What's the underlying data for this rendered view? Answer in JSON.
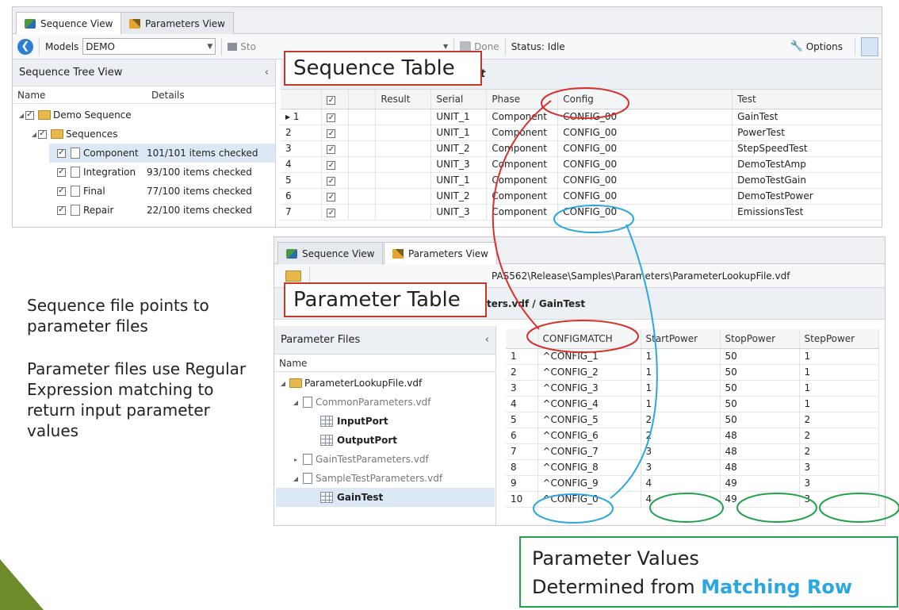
{
  "seq_screenshot": {
    "tabs": [
      "Sequence View",
      "Parameters View"
    ],
    "toolbar": {
      "models_label": "Models",
      "models_value": "DEMO",
      "stop_label": "Sto",
      "done_label": "Done",
      "status": "Status: Idle",
      "options_label": "Options"
    },
    "tree": {
      "title": "Sequence Tree View",
      "col_name": "Name",
      "col_details": "Details",
      "nodes": [
        {
          "label": "Demo Sequence",
          "details": ""
        },
        {
          "label": "Sequences",
          "details": ""
        },
        {
          "label": "Component",
          "details": "101/101 items checked"
        },
        {
          "label": "Integration",
          "details": "93/100 items checked"
        },
        {
          "label": "Final",
          "details": "77/100 items checked"
        },
        {
          "label": "Repair",
          "details": "22/100 items checked"
        }
      ]
    },
    "grid_title_fragment": "t",
    "grid": {
      "headers": [
        "",
        "✓",
        "",
        "Result",
        "Serial",
        "Phase",
        "Config",
        "Test"
      ],
      "rows": [
        {
          "n": "1",
          "serial": "UNIT_1",
          "phase": "Component",
          "config": "CONFIG_00",
          "test": "GainTest"
        },
        {
          "n": "2",
          "serial": "UNIT_1",
          "phase": "Component",
          "config": "CONFIG_00",
          "test": "PowerTest"
        },
        {
          "n": "3",
          "serial": "UNIT_2",
          "phase": "Component",
          "config": "CONFIG_00",
          "test": "StepSpeedTest"
        },
        {
          "n": "4",
          "serial": "UNIT_3",
          "phase": "Component",
          "config": "CONFIG_00",
          "test": "DemoTestAmp"
        },
        {
          "n": "5",
          "serial": "UNIT_1",
          "phase": "Component",
          "config": "CONFIG_00",
          "test": "DemoTestGain"
        },
        {
          "n": "6",
          "serial": "UNIT_2",
          "phase": "Component",
          "config": "CONFIG_00",
          "test": "DemoTestPower"
        },
        {
          "n": "7",
          "serial": "UNIT_3",
          "phase": "Component",
          "config": "CONFIG_00",
          "test": "EmissionsTest"
        }
      ]
    }
  },
  "param_screenshot": {
    "tabs": [
      "Sequence View",
      "Parameters View"
    ],
    "path": "PAS562\\Release\\Samples\\Parameters\\ParameterLookupFile.vdf",
    "grid_title": "ters.vdf / GainTest",
    "files_title": "Parameter Files",
    "files_col": "Name",
    "files": [
      {
        "label": "ParameterLookupFile.vdf",
        "kind": "file",
        "bold": false
      },
      {
        "label": "CommonParameters.vdf",
        "kind": "file",
        "bold": false
      },
      {
        "label": "InputPort",
        "kind": "grid",
        "bold": true
      },
      {
        "label": "OutputPort",
        "kind": "grid",
        "bold": true
      },
      {
        "label": "GainTestParameters.vdf",
        "kind": "file",
        "bold": false
      },
      {
        "label": "SampleTestParameters.vdf",
        "kind": "file",
        "bold": false
      },
      {
        "label": "GainTest",
        "kind": "grid",
        "bold": true
      }
    ],
    "grid": {
      "headers": [
        "",
        "CONFIGMATCH",
        "StartPower",
        "StopPower",
        "StepPower"
      ],
      "rows": [
        [
          "1",
          "^CONFIG_1",
          "1",
          "50",
          "1"
        ],
        [
          "2",
          "^CONFIG_2",
          "1",
          "50",
          "1"
        ],
        [
          "3",
          "^CONFIG_3",
          "1",
          "50",
          "1"
        ],
        [
          "4",
          "^CONFIG_4",
          "1",
          "50",
          "1"
        ],
        [
          "5",
          "^CONFIG_5",
          "2",
          "50",
          "2"
        ],
        [
          "6",
          "^CONFIG_6",
          "2",
          "48",
          "2"
        ],
        [
          "7",
          "^CONFIG_7",
          "3",
          "48",
          "2"
        ],
        [
          "8",
          "^CONFIG_8",
          "3",
          "48",
          "3"
        ],
        [
          "9",
          "^CONFIG_9",
          "4",
          "49",
          "3"
        ],
        [
          "10",
          "^CONFIG_0",
          "4",
          "49",
          "3"
        ]
      ]
    }
  },
  "callouts": {
    "sequence_table": "Sequence Table",
    "parameter_table": "Parameter Table",
    "values_line1": "Parameter Values",
    "values_line2_prefix": "Determined from ",
    "values_line2_highlight": "Matching Row"
  },
  "body_text": {
    "para1": "Sequence file points to parameter files",
    "para2": "Parameter files use Regular Expression matching to return input parameter values"
  },
  "colors": {
    "red": "#d9302b",
    "blue": "#2aa7e0",
    "green": "#20a24a",
    "accent_triangle": "#6e8a2a"
  }
}
